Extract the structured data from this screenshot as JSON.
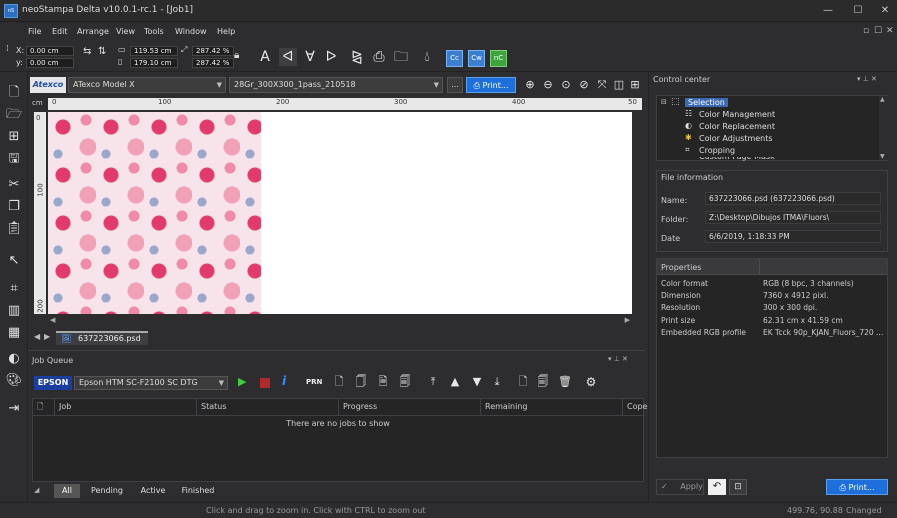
{
  "window": {
    "title": "neoStampa Delta  v10.0.1-rc.1 - [Job1]",
    "icon": "app-icon",
    "minimize": "—",
    "maximize": "☐",
    "close": "✕"
  },
  "menu": [
    "File",
    "Edit",
    "Arrange",
    "View",
    "Tools",
    "Window",
    "Help"
  ],
  "toolbar": {
    "x_label": "X:",
    "x_value": "0.00 cm",
    "y_label": "y:",
    "y_value": "0.00 cm",
    "width_value": "119.53 cm",
    "height_value": "179.10 cm",
    "scale_w": "287.42 %",
    "scale_h": "287.42 %"
  },
  "printbar": {
    "brand": "Atexco",
    "printer": "ATexco Model X",
    "profile": "28Gr_300X300_1pass_210518",
    "more": "...",
    "print_label": "Print..."
  },
  "ruler": {
    "h_ticks": [
      "0",
      "100",
      "200",
      "300",
      "400",
      "50"
    ],
    "v_ticks": [
      "0",
      "100",
      "200"
    ],
    "unit": "cm"
  },
  "document": {
    "tab_label": "637223066.psd"
  },
  "job_queue": {
    "title": "Job Queue",
    "brand": "EPSON",
    "printer": "Epson HTM SC-F2100 SC DTG",
    "prn": "PRN",
    "columns": [
      "Job",
      "Status",
      "Progress",
      "Remaining",
      "Cope"
    ],
    "empty_text": "There are no jobs to show",
    "tabs": [
      "All",
      "Pending",
      "Active",
      "Finished"
    ]
  },
  "control_center": {
    "title": "Control center",
    "tree": [
      "Selection",
      "Color Management",
      "Color Replacement",
      "Color Adjustments",
      "Cropping",
      "Custom Page Mask"
    ]
  },
  "file_info": {
    "title": "File information",
    "name_label": "Name:",
    "name_value": "637223066.psd (637223066.psd)",
    "folder_label": "Folder:",
    "folder_value": "Z:\\Desktop\\Dibujos ITMA\\Fluors\\",
    "date_label": "Date",
    "date_value": "6/6/2019, 1:18:33 PM"
  },
  "properties": {
    "title": "Properties",
    "rows": [
      {
        "k": "Color format",
        "v": "RGB (8 bpc, 3 channels)"
      },
      {
        "k": "Dimension",
        "v": "7360 x 4912 pixl."
      },
      {
        "k": "Resolution",
        "v": "300 x 300 dpi."
      },
      {
        "k": "Print size",
        "v": "62.31 cm x 41.59 cm"
      },
      {
        "k": "Embedded RGB profile",
        "v": "EK Tcck 90p_KJAN_Fluors_720 ..."
      }
    ]
  },
  "actions": {
    "apply": "Apply",
    "print": "Print..."
  },
  "status": {
    "hint": "Click and drag to zoom in. Click with CTRL to zoom out",
    "coords": "499.76, 90.88",
    "state": "Changed"
  }
}
